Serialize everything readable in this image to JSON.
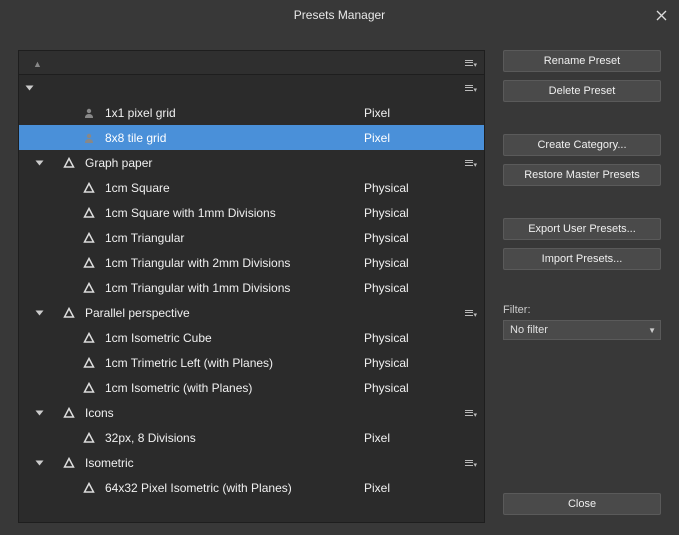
{
  "title": "Presets Manager",
  "buttons": {
    "rename": "Rename Preset",
    "delete": "Delete Preset",
    "create_category": "Create Category...",
    "restore_master": "Restore Master Presets",
    "export_user": "Export User Presets...",
    "import_presets": "Import Presets...",
    "close": "Close"
  },
  "filter": {
    "label": "Filter:",
    "value": "No filter"
  },
  "tree": [
    {
      "kind": "category_root",
      "level": 0,
      "expanded": true,
      "label": "",
      "type": "",
      "menu": true
    },
    {
      "kind": "preset",
      "level": 2,
      "icon": "user",
      "label": "1x1 pixel grid",
      "type": "Pixel",
      "selected": false
    },
    {
      "kind": "preset",
      "level": 2,
      "icon": "user",
      "label": "8x8 tile grid",
      "type": "Pixel",
      "selected": true
    },
    {
      "kind": "category",
      "level": 1,
      "expanded": true,
      "icon": "affinity",
      "label": "Graph paper",
      "type": "",
      "menu": true
    },
    {
      "kind": "preset",
      "level": 2,
      "icon": "affinity",
      "label": "1cm Square",
      "type": "Physical"
    },
    {
      "kind": "preset",
      "level": 2,
      "icon": "affinity",
      "label": "1cm Square with 1mm Divisions",
      "type": "Physical"
    },
    {
      "kind": "preset",
      "level": 2,
      "icon": "affinity",
      "label": "1cm Triangular",
      "type": "Physical"
    },
    {
      "kind": "preset",
      "level": 2,
      "icon": "affinity",
      "label": "1cm Triangular with 2mm Divisions",
      "type": "Physical"
    },
    {
      "kind": "preset",
      "level": 2,
      "icon": "affinity",
      "label": "1cm Triangular with 1mm Divisions",
      "type": "Physical"
    },
    {
      "kind": "category",
      "level": 1,
      "expanded": true,
      "icon": "affinity",
      "label": "Parallel perspective",
      "type": "",
      "menu": true
    },
    {
      "kind": "preset",
      "level": 2,
      "icon": "affinity",
      "label": "1cm Isometric Cube",
      "type": "Physical"
    },
    {
      "kind": "preset",
      "level": 2,
      "icon": "affinity",
      "label": "1cm Trimetric Left (with Planes)",
      "type": "Physical"
    },
    {
      "kind": "preset",
      "level": 2,
      "icon": "affinity",
      "label": "1cm Isometric (with Planes)",
      "type": "Physical"
    },
    {
      "kind": "category",
      "level": 1,
      "expanded": true,
      "icon": "affinity",
      "label": "Icons",
      "type": "",
      "menu": true
    },
    {
      "kind": "preset",
      "level": 2,
      "icon": "affinity",
      "label": "32px, 8 Divisions",
      "type": "Pixel"
    },
    {
      "kind": "category",
      "level": 1,
      "expanded": true,
      "icon": "affinity",
      "label": "Isometric",
      "type": "",
      "menu": true
    },
    {
      "kind": "preset",
      "level": 2,
      "icon": "affinity",
      "label": "64x32 Pixel Isometric (with Planes)",
      "type": "Pixel"
    }
  ]
}
